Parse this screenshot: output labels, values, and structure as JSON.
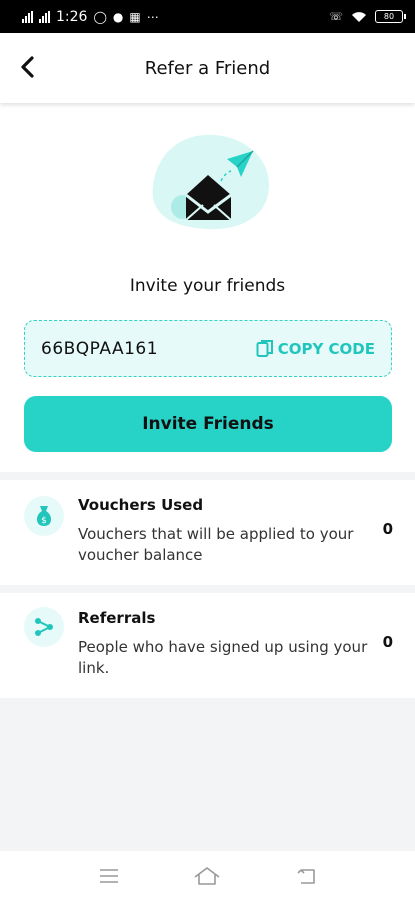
{
  "status_bar": {
    "time": "1:26",
    "battery": "80"
  },
  "header": {
    "title": "Refer a Friend"
  },
  "invite": {
    "heading": "Invite your friends",
    "code": "66BQPAA161",
    "copy_label": "COPY CODE",
    "button_label": "Invite Friends"
  },
  "stats": [
    {
      "title": "Vouchers Used",
      "description": "Vouchers that will be applied to your voucher balance",
      "count": "0",
      "icon": "money-bag-icon"
    },
    {
      "title": "Referrals",
      "description": "People who have signed up using your link.",
      "count": "0",
      "icon": "share-icon"
    }
  ],
  "colors": {
    "accent": "#27d3c7",
    "accent_light": "#e6faf9",
    "background_gray": "#f3f4f5"
  }
}
